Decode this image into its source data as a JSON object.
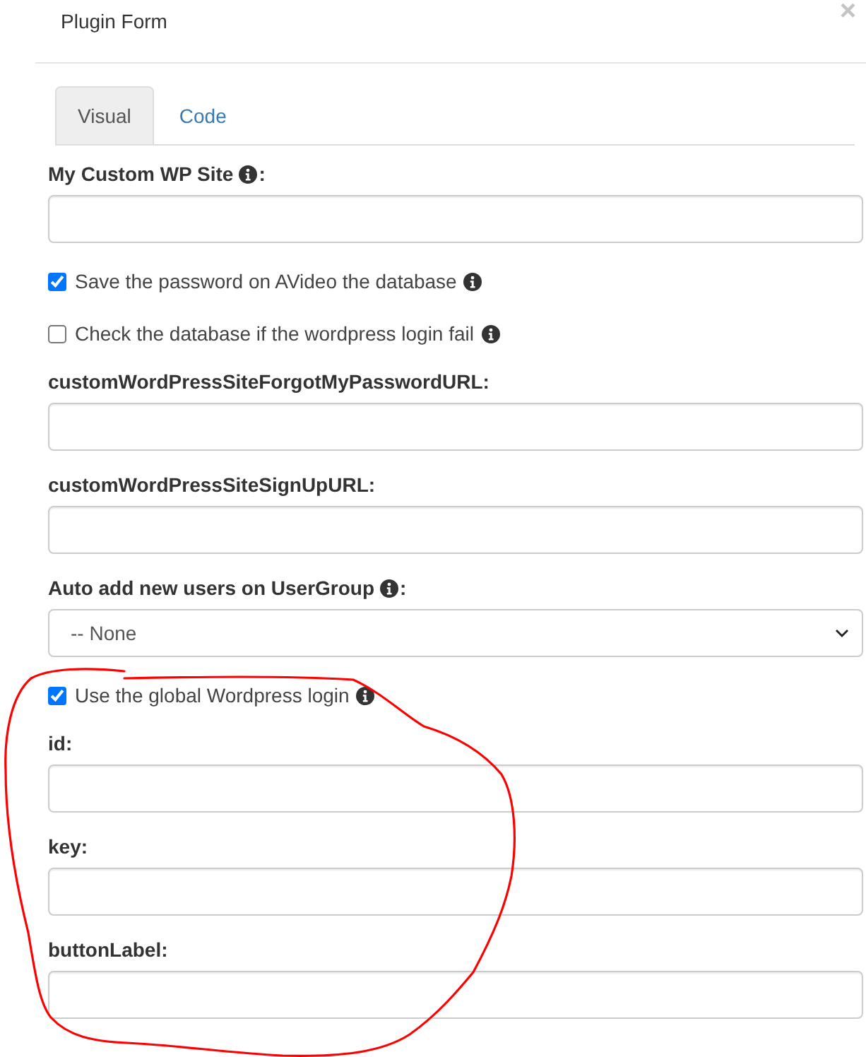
{
  "dialog": {
    "title": "Plugin Form",
    "close": "×"
  },
  "tabs": [
    {
      "label": "Visual",
      "selected": true
    },
    {
      "label": "Code",
      "selected": false
    }
  ],
  "fields": [
    {
      "kind": "text",
      "label": "My Custom WP Site",
      "info": true,
      "label_end": ":"
    },
    {
      "kind": "checkbox",
      "label": "Save the password on AVideo the database",
      "checked": true,
      "info": true
    },
    {
      "kind": "checkbox",
      "label": "Check the database if the wordpress login fail",
      "checked": false,
      "info": true
    },
    {
      "kind": "text",
      "label": "customWordPressSiteForgotMyPasswordURL:",
      "info": false
    },
    {
      "kind": "text",
      "label": "customWordPressSiteSignUpURL:",
      "info": false
    },
    {
      "kind": "select",
      "label": "Auto add new users on UserGroup",
      "info": true,
      "label_end": ":",
      "value": "-- None"
    },
    {
      "kind": "checkbox",
      "label": "Use the global Wordpress login",
      "checked": true,
      "info": true
    },
    {
      "kind": "text",
      "label": "id:",
      "info": false
    },
    {
      "kind": "text",
      "label": "key:",
      "info": false
    },
    {
      "kind": "text",
      "label": "buttonLabel:",
      "info": false
    }
  ],
  "annotation": {
    "kind": "freehand-circle"
  }
}
